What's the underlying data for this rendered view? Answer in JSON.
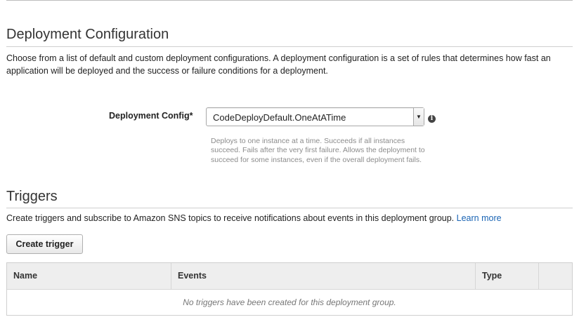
{
  "deployment_configuration": {
    "title": "Deployment Configuration",
    "description": "Choose from a list of default and custom deployment configurations. A deployment configuration is a set of rules that determines how fast an application will be deployed and the success or failure conditions for a deployment.",
    "field_label": "Deployment Config*",
    "selected_value": "CodeDeployDefault.OneAtATime",
    "help_text": "Deploys to one instance at a time. Succeeds if all instances succeed. Fails after the very first failure. Allows the deployment to succeed for some instances, even if the overall deployment fails."
  },
  "triggers": {
    "title": "Triggers",
    "description": "Create triggers and subscribe to Amazon SNS topics to receive notifications about events in this deployment group.",
    "learn_more": "Learn more",
    "create_button": "Create trigger",
    "table": {
      "columns": [
        "Name",
        "Events",
        "Type",
        ""
      ],
      "empty_message": "No triggers have been created for this deployment group."
    }
  }
}
